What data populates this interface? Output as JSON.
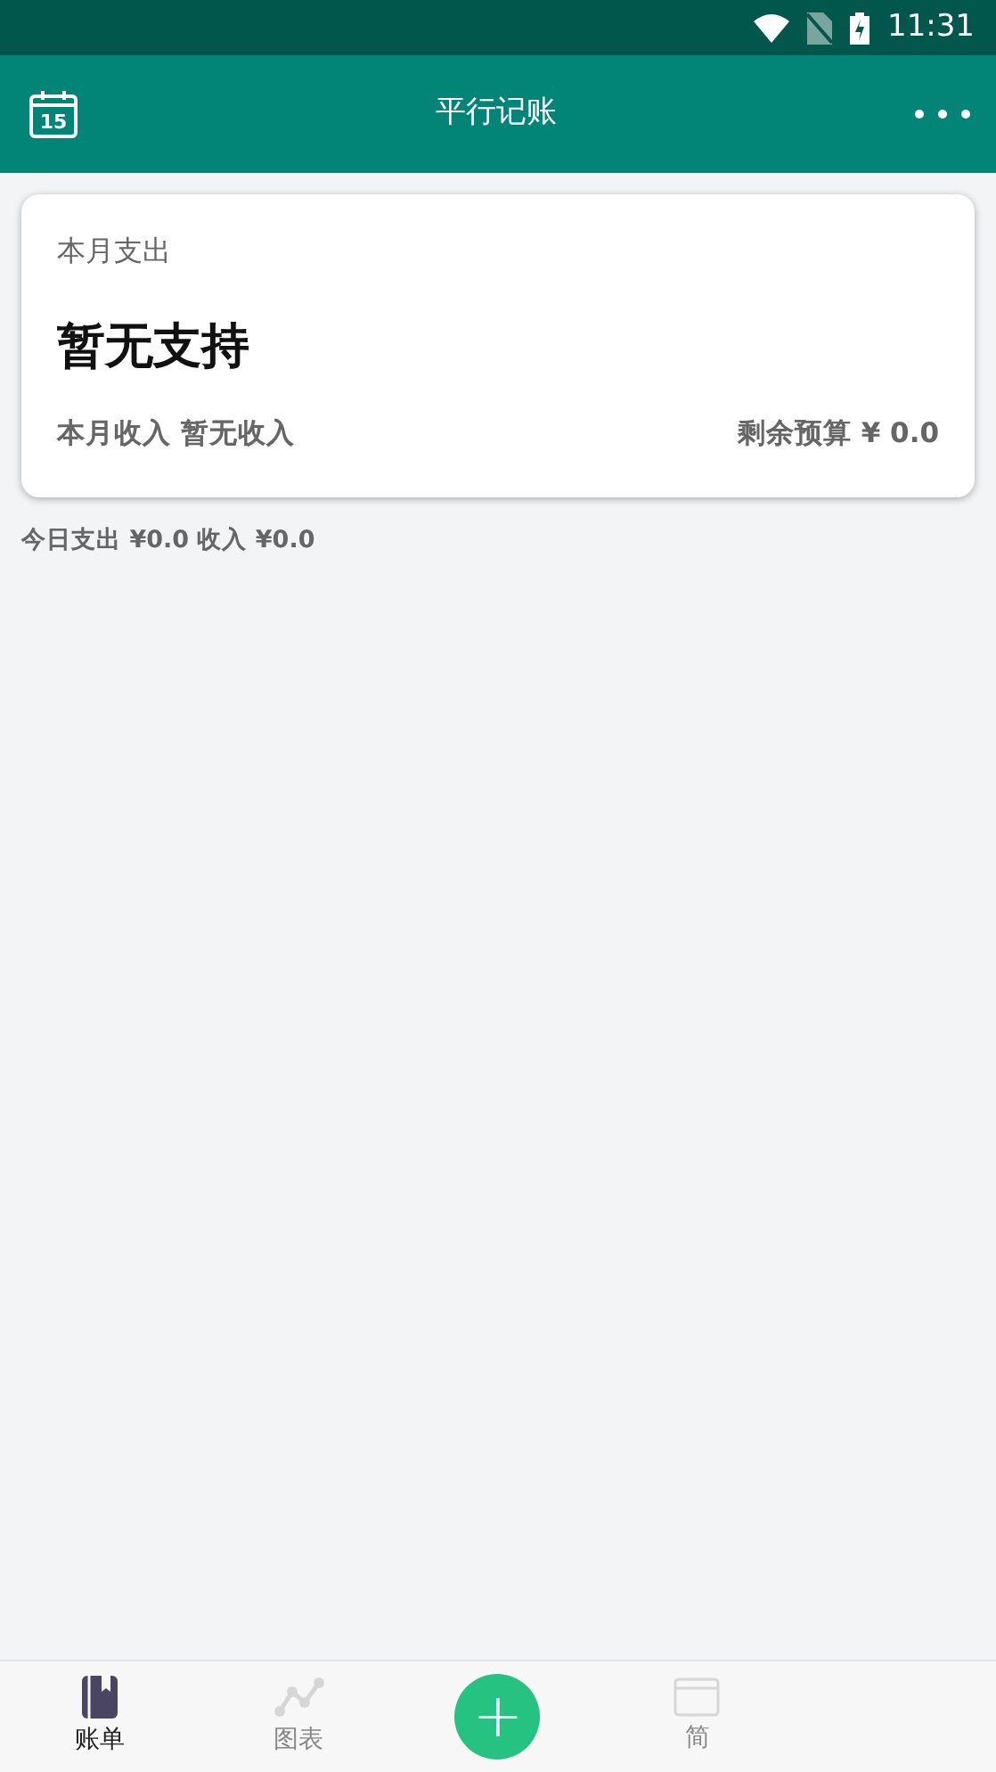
{
  "status_bar": {
    "time": "11:31"
  },
  "app_bar": {
    "title": "平行记账",
    "calendar_day": "15"
  },
  "summary_card": {
    "label": "本月支出",
    "amount": "暂无支持",
    "income_label": "本月收入",
    "income_value": "暂无收入",
    "budget": "剩余预算 ¥ 0.0"
  },
  "today": "今日支出 ¥0.0 收入 ¥0.0",
  "bottom_nav": [
    {
      "kind": "tab",
      "label": "账单",
      "selected": true
    },
    {
      "kind": "tab",
      "label": "图表",
      "selected": false
    },
    {
      "kind": "add",
      "label": "+"
    },
    {
      "kind": "tab",
      "label": "简",
      "selected": false
    }
  ]
}
